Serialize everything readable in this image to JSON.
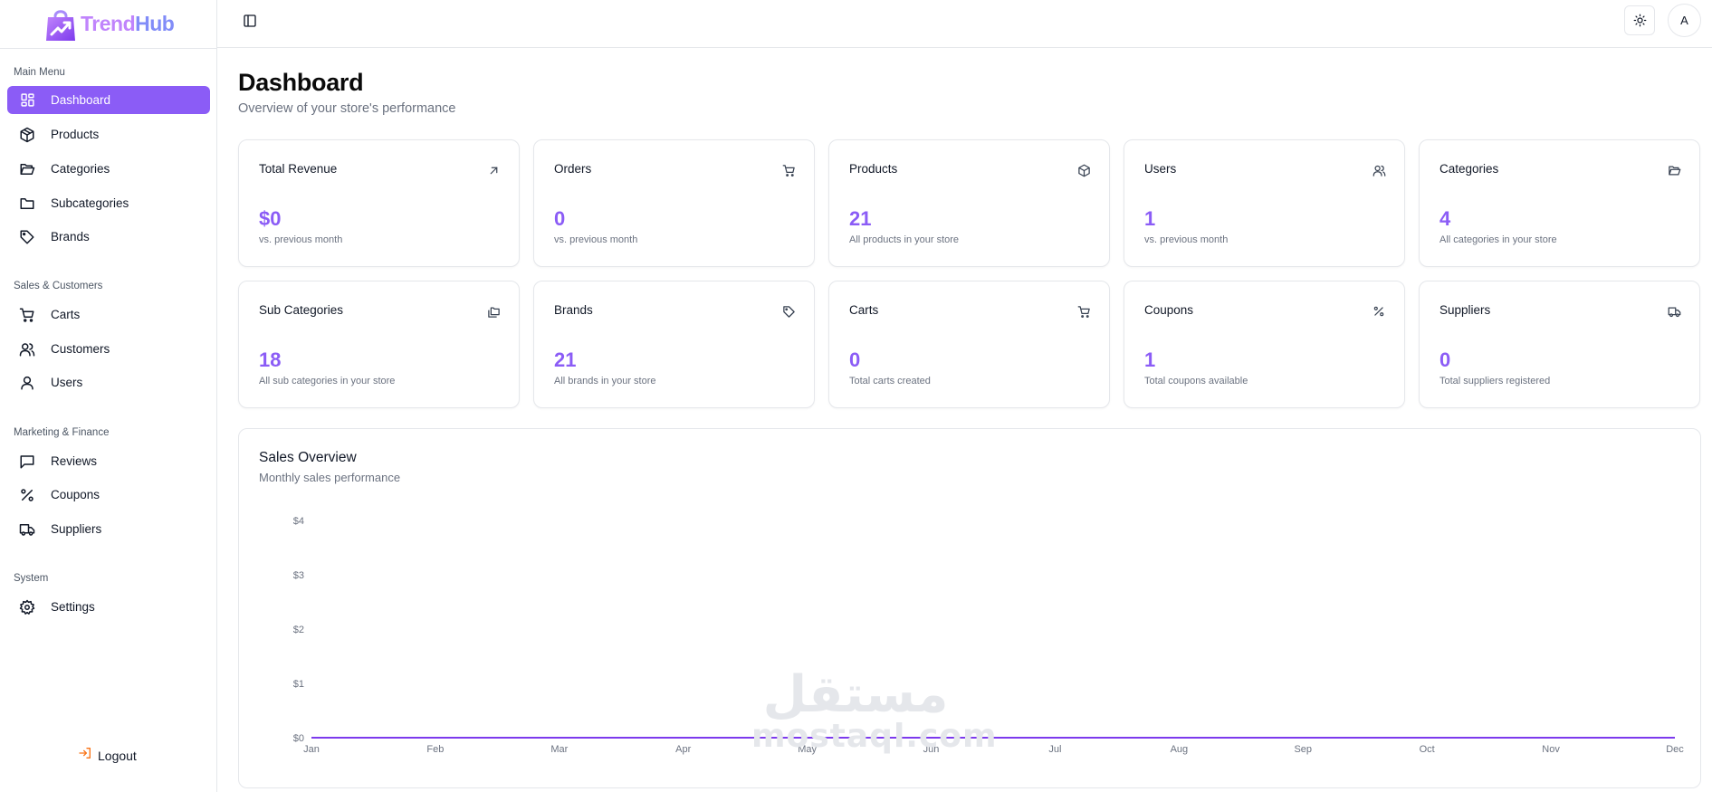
{
  "app": {
    "brand_part1": "Trend",
    "brand_part2": "Hub",
    "brand_colors": [
      "#c084fc",
      "#818cf8"
    ],
    "accent": "#8b5cf6"
  },
  "sidebar": {
    "sections": [
      {
        "label": "Main Menu",
        "items": [
          {
            "label": "Dashboard",
            "icon": "dashboard-grid-icon",
            "active": true
          },
          {
            "label": "Products",
            "icon": "package-icon"
          },
          {
            "label": "Categories",
            "icon": "folder-open-icon"
          },
          {
            "label": "Subcategories",
            "icon": "folder-icon"
          },
          {
            "label": "Brands",
            "icon": "tag-icon"
          }
        ]
      },
      {
        "label": "Sales & Customers",
        "items": [
          {
            "label": "Carts",
            "icon": "cart-icon"
          },
          {
            "label": "Customers",
            "icon": "users-icon"
          },
          {
            "label": "Users",
            "icon": "user-icon"
          }
        ]
      },
      {
        "label": "Marketing & Finance",
        "items": [
          {
            "label": "Reviews",
            "icon": "message-square-icon"
          },
          {
            "label": "Coupons",
            "icon": "percent-icon"
          },
          {
            "label": "Suppliers",
            "icon": "truck-icon"
          }
        ]
      },
      {
        "label": "System",
        "items": [
          {
            "label": "Settings",
            "icon": "gear-icon"
          }
        ]
      }
    ],
    "logout_label": "Logout"
  },
  "topbar": {
    "avatar_initial": "A"
  },
  "header": {
    "title": "Dashboard",
    "subtitle": "Overview of your store's performance"
  },
  "stats": [
    {
      "title": "Total Revenue",
      "value": "$0",
      "sub": "vs. previous month",
      "icon": "arrow-up-right-icon"
    },
    {
      "title": "Orders",
      "value": "0",
      "sub": "vs. previous month",
      "icon": "cart-icon"
    },
    {
      "title": "Products",
      "value": "21",
      "sub": "All products in your store",
      "icon": "package-icon"
    },
    {
      "title": "Users",
      "value": "1",
      "sub": "vs. previous month",
      "icon": "users-icon"
    },
    {
      "title": "Categories",
      "value": "4",
      "sub": "All categories in your store",
      "icon": "folder-open-icon"
    },
    {
      "title": "Sub Categories",
      "value": "18",
      "sub": "All sub categories in your store",
      "icon": "folders-icon"
    },
    {
      "title": "Brands",
      "value": "21",
      "sub": "All brands in your store",
      "icon": "tag-icon"
    },
    {
      "title": "Carts",
      "value": "0",
      "sub": "Total carts created",
      "icon": "cart-icon"
    },
    {
      "title": "Coupons",
      "value": "1",
      "sub": "Total coupons available",
      "icon": "percent-icon"
    },
    {
      "title": "Suppliers",
      "value": "0",
      "sub": "Total suppliers registered",
      "icon": "truck-icon"
    }
  ],
  "sales": {
    "title": "Sales Overview",
    "subtitle": "Monthly sales performance"
  },
  "chart_data": {
    "type": "line",
    "categories": [
      "Jan",
      "Feb",
      "Mar",
      "Apr",
      "May",
      "Jun",
      "Jul",
      "Aug",
      "Sep",
      "Oct",
      "Nov",
      "Dec"
    ],
    "series": [
      {
        "values": [
          0,
          0,
          0,
          0,
          0,
          0,
          0,
          0,
          0,
          0,
          0,
          0
        ],
        "color": "#7c3aed"
      }
    ],
    "yticks": [
      "$0",
      "$1",
      "$2",
      "$3",
      "$4"
    ],
    "ylim": [
      0,
      4
    ],
    "grid": false
  },
  "watermark": {
    "arabic": "مستقل",
    "latin": "mostaql.com"
  }
}
